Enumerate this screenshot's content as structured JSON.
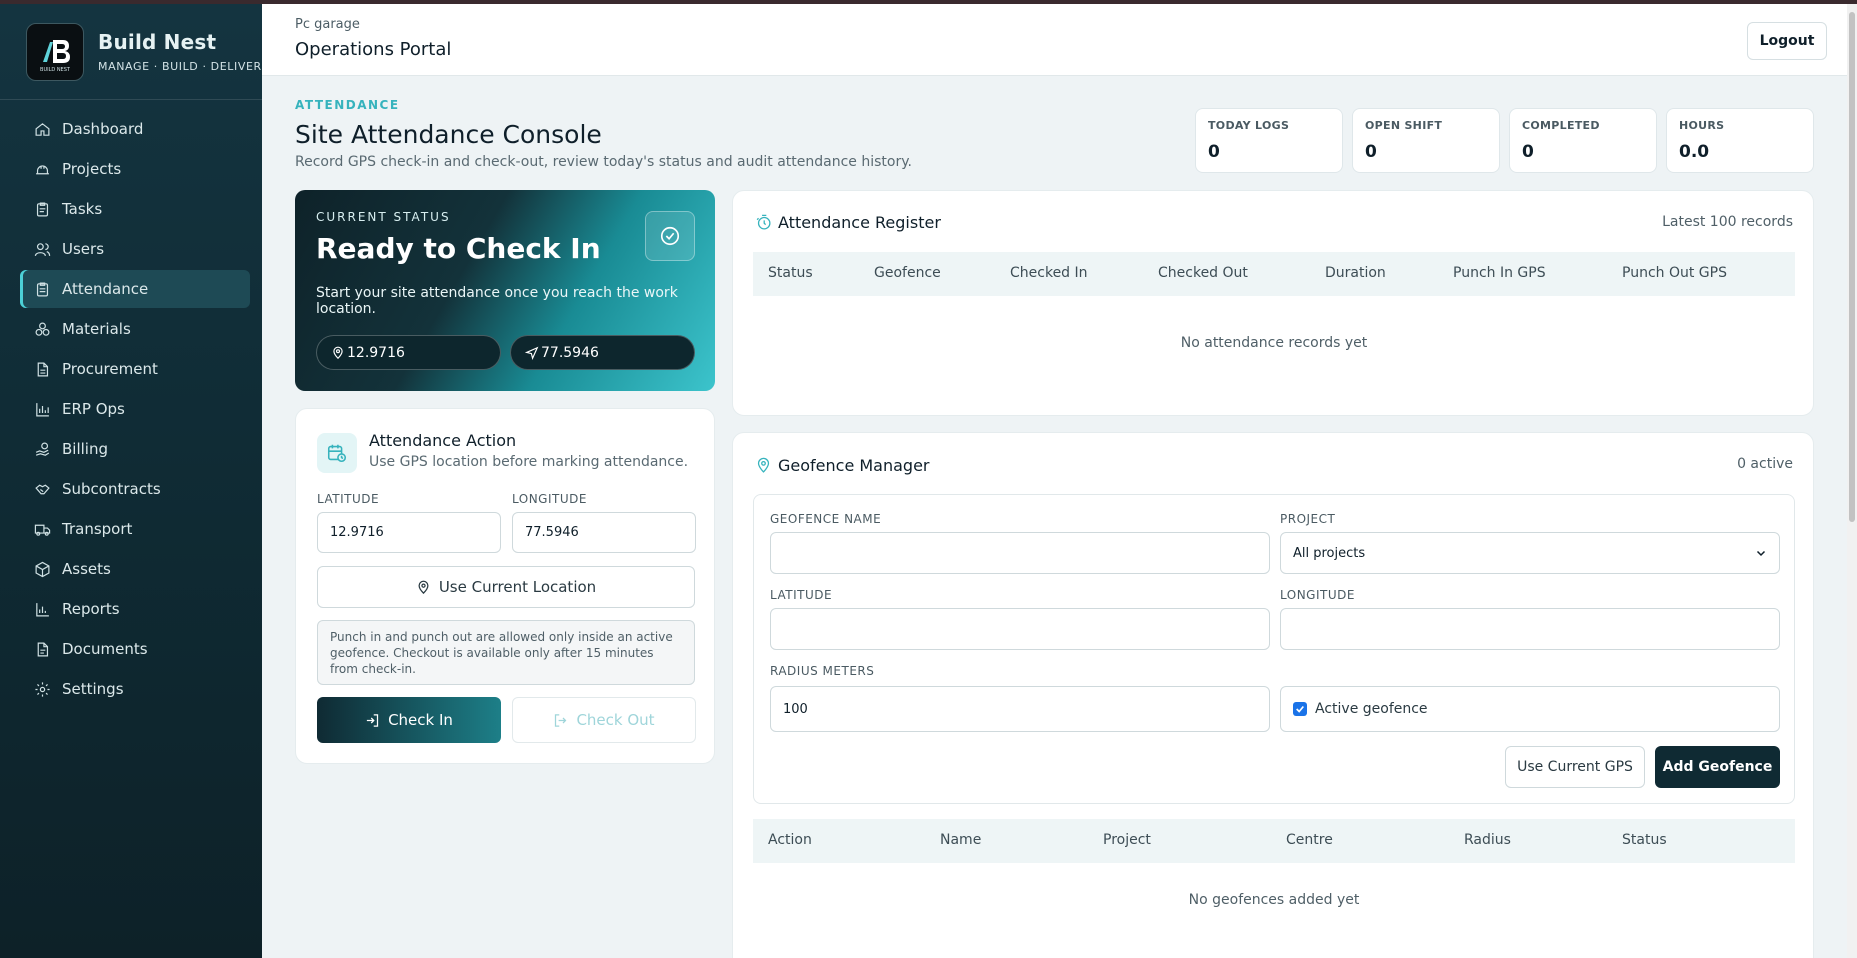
{
  "brand": {
    "name": "Build Nest",
    "tagline": "MANAGE · BUILD · DELIVER",
    "logo_text": "BUILD NEST"
  },
  "nav": [
    {
      "label": "Dashboard",
      "icon": "home-icon"
    },
    {
      "label": "Projects",
      "icon": "hardhat-icon"
    },
    {
      "label": "Tasks",
      "icon": "clipboard-icon"
    },
    {
      "label": "Users",
      "icon": "users-icon"
    },
    {
      "label": "Attendance",
      "icon": "clipboard-check-icon",
      "active": true
    },
    {
      "label": "Materials",
      "icon": "boxes-icon"
    },
    {
      "label": "Procurement",
      "icon": "file-icon"
    },
    {
      "label": "ERP Ops",
      "icon": "bar-chart-icon"
    },
    {
      "label": "Billing",
      "icon": "hand-coins-icon"
    },
    {
      "label": "Subcontracts",
      "icon": "handshake-icon"
    },
    {
      "label": "Transport",
      "icon": "truck-icon"
    },
    {
      "label": "Assets",
      "icon": "package-icon"
    },
    {
      "label": "Reports",
      "icon": "chart-icon"
    },
    {
      "label": "Documents",
      "icon": "document-icon"
    },
    {
      "label": "Settings",
      "icon": "gear-icon"
    }
  ],
  "header": {
    "org": "Pc garage",
    "title": "Operations Portal",
    "logout": "Logout"
  },
  "page": {
    "eyebrow": "ATTENDANCE",
    "title": "Site Attendance Console",
    "description": "Record GPS check-in and check-out, review today's status and audit attendance history."
  },
  "stats": [
    {
      "label": "TODAY LOGS",
      "value": "0"
    },
    {
      "label": "OPEN SHIFT",
      "value": "0"
    },
    {
      "label": "COMPLETED",
      "value": "0"
    },
    {
      "label": "HOURS",
      "value": "0.0"
    }
  ],
  "status": {
    "eyebrow": "CURRENT STATUS",
    "title": "Ready to Check In",
    "description": "Start your site attendance once you reach the work location.",
    "lat": "12.9716",
    "lng": "77.5946"
  },
  "action": {
    "title": "Attendance Action",
    "subtitle": "Use GPS location before marking attendance.",
    "lat_label": "LATITUDE",
    "lng_label": "LONGITUDE",
    "lat_value": "12.9716",
    "lng_value": "77.5946",
    "use_location": "Use Current Location",
    "note": "Punch in and punch out are allowed only inside an active geofence. Checkout is available only after 15 minutes from check-in.",
    "check_in": "Check In",
    "check_out": "Check Out"
  },
  "register": {
    "title": "Attendance Register",
    "meta": "Latest 100 records",
    "columns": [
      "Status",
      "Geofence",
      "Checked In",
      "Checked Out",
      "Duration",
      "Punch In GPS",
      "Punch Out GPS"
    ],
    "empty": "No attendance records yet"
  },
  "geofence": {
    "title": "Geofence Manager",
    "meta": "0 active",
    "name_label": "GEOFENCE NAME",
    "project_label": "PROJECT",
    "project_value": "All projects",
    "lat_label": "LATITUDE",
    "lng_label": "LONGITUDE",
    "radius_label": "RADIUS METERS",
    "radius_value": "100",
    "active_label": "Active geofence",
    "use_gps": "Use Current GPS",
    "add": "Add Geofence",
    "columns": [
      "Action",
      "Name",
      "Project",
      "Centre",
      "Radius",
      "Status"
    ],
    "empty": "No geofences added yet"
  }
}
